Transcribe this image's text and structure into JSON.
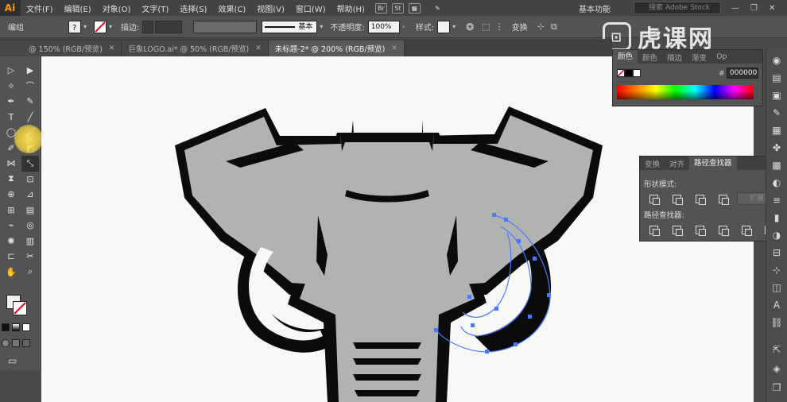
{
  "app": {
    "logo": "Ai"
  },
  "menubar": {
    "items": [
      "文件(F)",
      "编辑(E)",
      "对象(O)",
      "文字(T)",
      "选择(S)",
      "效果(C)",
      "视图(V)",
      "窗口(W)",
      "帮助(H)"
    ],
    "bridge_icon": "Br",
    "stock_icon": "St",
    "workspace": "基本功能",
    "stock_search_placeholder": "搜索 Adobe Stock",
    "window_controls": [
      "—",
      "❐",
      "✕"
    ]
  },
  "controlbar": {
    "selection_label": "编组",
    "stroke_label": "描边:",
    "stroke_style_label": "基本",
    "opacity_label": "不透明度:",
    "opacity_value": "100%",
    "style_label": "样式:",
    "transform_label": "变换"
  },
  "watermark": {
    "text": "虎课网"
  },
  "doc_tabs": [
    {
      "label": "@ 150% (RGB/预览)",
      "active": false
    },
    {
      "label": "巨象LOGO.ai* @ 50% (RGB/预览)",
      "active": false
    },
    {
      "label": "未标题-2* @ 200% (RGB/预览)",
      "active": true
    }
  ],
  "color_panel": {
    "tabs": [
      "颜色",
      "颜色",
      "描边",
      "渐变",
      "Op"
    ],
    "hex_prefix": "#",
    "hex_value": "000000"
  },
  "pathfinder_panel": {
    "tabs": [
      "变换",
      "对齐",
      "路径查找器"
    ],
    "shape_modes_label": "形状模式:",
    "pathfinders_label": "路径查找器:",
    "expand_label": "扩展"
  },
  "colors": {
    "elephant_fill": "#b1b3b0",
    "outline": "#0b0b0b",
    "selection": "#4a78ff",
    "canvas": "#f8f9f6"
  }
}
